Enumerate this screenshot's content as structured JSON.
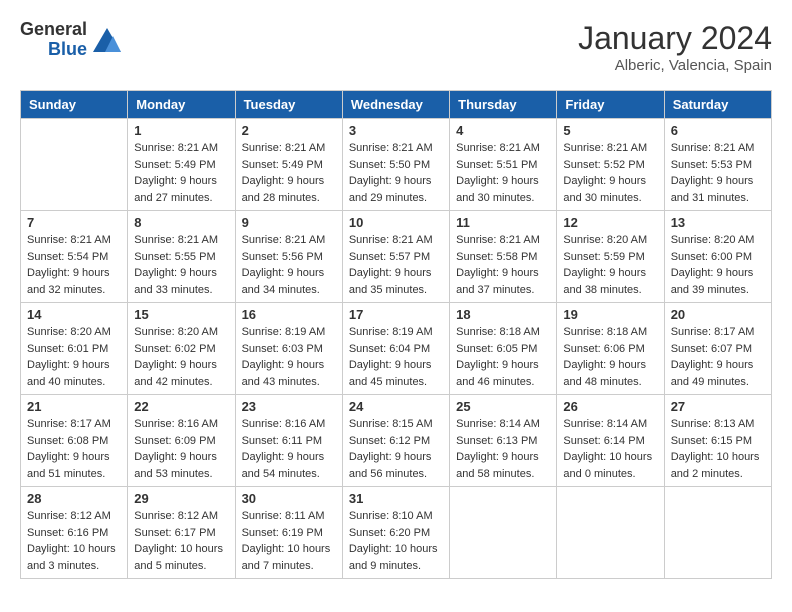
{
  "header": {
    "logo_general": "General",
    "logo_blue": "Blue",
    "month": "January 2024",
    "location": "Alberic, Valencia, Spain"
  },
  "weekdays": [
    "Sunday",
    "Monday",
    "Tuesday",
    "Wednesday",
    "Thursday",
    "Friday",
    "Saturday"
  ],
  "weeks": [
    [
      {
        "day": "",
        "sunrise": "",
        "sunset": "",
        "daylight": "",
        "empty": true
      },
      {
        "day": "1",
        "sunrise": "Sunrise: 8:21 AM",
        "sunset": "Sunset: 5:49 PM",
        "daylight": "Daylight: 9 hours and 27 minutes."
      },
      {
        "day": "2",
        "sunrise": "Sunrise: 8:21 AM",
        "sunset": "Sunset: 5:49 PM",
        "daylight": "Daylight: 9 hours and 28 minutes."
      },
      {
        "day": "3",
        "sunrise": "Sunrise: 8:21 AM",
        "sunset": "Sunset: 5:50 PM",
        "daylight": "Daylight: 9 hours and 29 minutes."
      },
      {
        "day": "4",
        "sunrise": "Sunrise: 8:21 AM",
        "sunset": "Sunset: 5:51 PM",
        "daylight": "Daylight: 9 hours and 30 minutes."
      },
      {
        "day": "5",
        "sunrise": "Sunrise: 8:21 AM",
        "sunset": "Sunset: 5:52 PM",
        "daylight": "Daylight: 9 hours and 30 minutes."
      },
      {
        "day": "6",
        "sunrise": "Sunrise: 8:21 AM",
        "sunset": "Sunset: 5:53 PM",
        "daylight": "Daylight: 9 hours and 31 minutes."
      }
    ],
    [
      {
        "day": "7",
        "sunrise": "Sunrise: 8:21 AM",
        "sunset": "Sunset: 5:54 PM",
        "daylight": "Daylight: 9 hours and 32 minutes."
      },
      {
        "day": "8",
        "sunrise": "Sunrise: 8:21 AM",
        "sunset": "Sunset: 5:55 PM",
        "daylight": "Daylight: 9 hours and 33 minutes."
      },
      {
        "day": "9",
        "sunrise": "Sunrise: 8:21 AM",
        "sunset": "Sunset: 5:56 PM",
        "daylight": "Daylight: 9 hours and 34 minutes."
      },
      {
        "day": "10",
        "sunrise": "Sunrise: 8:21 AM",
        "sunset": "Sunset: 5:57 PM",
        "daylight": "Daylight: 9 hours and 35 minutes."
      },
      {
        "day": "11",
        "sunrise": "Sunrise: 8:21 AM",
        "sunset": "Sunset: 5:58 PM",
        "daylight": "Daylight: 9 hours and 37 minutes."
      },
      {
        "day": "12",
        "sunrise": "Sunrise: 8:20 AM",
        "sunset": "Sunset: 5:59 PM",
        "daylight": "Daylight: 9 hours and 38 minutes."
      },
      {
        "day": "13",
        "sunrise": "Sunrise: 8:20 AM",
        "sunset": "Sunset: 6:00 PM",
        "daylight": "Daylight: 9 hours and 39 minutes."
      }
    ],
    [
      {
        "day": "14",
        "sunrise": "Sunrise: 8:20 AM",
        "sunset": "Sunset: 6:01 PM",
        "daylight": "Daylight: 9 hours and 40 minutes."
      },
      {
        "day": "15",
        "sunrise": "Sunrise: 8:20 AM",
        "sunset": "Sunset: 6:02 PM",
        "daylight": "Daylight: 9 hours and 42 minutes."
      },
      {
        "day": "16",
        "sunrise": "Sunrise: 8:19 AM",
        "sunset": "Sunset: 6:03 PM",
        "daylight": "Daylight: 9 hours and 43 minutes."
      },
      {
        "day": "17",
        "sunrise": "Sunrise: 8:19 AM",
        "sunset": "Sunset: 6:04 PM",
        "daylight": "Daylight: 9 hours and 45 minutes."
      },
      {
        "day": "18",
        "sunrise": "Sunrise: 8:18 AM",
        "sunset": "Sunset: 6:05 PM",
        "daylight": "Daylight: 9 hours and 46 minutes."
      },
      {
        "day": "19",
        "sunrise": "Sunrise: 8:18 AM",
        "sunset": "Sunset: 6:06 PM",
        "daylight": "Daylight: 9 hours and 48 minutes."
      },
      {
        "day": "20",
        "sunrise": "Sunrise: 8:17 AM",
        "sunset": "Sunset: 6:07 PM",
        "daylight": "Daylight: 9 hours and 49 minutes."
      }
    ],
    [
      {
        "day": "21",
        "sunrise": "Sunrise: 8:17 AM",
        "sunset": "Sunset: 6:08 PM",
        "daylight": "Daylight: 9 hours and 51 minutes."
      },
      {
        "day": "22",
        "sunrise": "Sunrise: 8:16 AM",
        "sunset": "Sunset: 6:09 PM",
        "daylight": "Daylight: 9 hours and 53 minutes."
      },
      {
        "day": "23",
        "sunrise": "Sunrise: 8:16 AM",
        "sunset": "Sunset: 6:11 PM",
        "daylight": "Daylight: 9 hours and 54 minutes."
      },
      {
        "day": "24",
        "sunrise": "Sunrise: 8:15 AM",
        "sunset": "Sunset: 6:12 PM",
        "daylight": "Daylight: 9 hours and 56 minutes."
      },
      {
        "day": "25",
        "sunrise": "Sunrise: 8:14 AM",
        "sunset": "Sunset: 6:13 PM",
        "daylight": "Daylight: 9 hours and 58 minutes."
      },
      {
        "day": "26",
        "sunrise": "Sunrise: 8:14 AM",
        "sunset": "Sunset: 6:14 PM",
        "daylight": "Daylight: 10 hours and 0 minutes."
      },
      {
        "day": "27",
        "sunrise": "Sunrise: 8:13 AM",
        "sunset": "Sunset: 6:15 PM",
        "daylight": "Daylight: 10 hours and 2 minutes."
      }
    ],
    [
      {
        "day": "28",
        "sunrise": "Sunrise: 8:12 AM",
        "sunset": "Sunset: 6:16 PM",
        "daylight": "Daylight: 10 hours and 3 minutes."
      },
      {
        "day": "29",
        "sunrise": "Sunrise: 8:12 AM",
        "sunset": "Sunset: 6:17 PM",
        "daylight": "Daylight: 10 hours and 5 minutes."
      },
      {
        "day": "30",
        "sunrise": "Sunrise: 8:11 AM",
        "sunset": "Sunset: 6:19 PM",
        "daylight": "Daylight: 10 hours and 7 minutes."
      },
      {
        "day": "31",
        "sunrise": "Sunrise: 8:10 AM",
        "sunset": "Sunset: 6:20 PM",
        "daylight": "Daylight: 10 hours and 9 minutes."
      },
      {
        "day": "",
        "sunrise": "",
        "sunset": "",
        "daylight": "",
        "empty": true
      },
      {
        "day": "",
        "sunrise": "",
        "sunset": "",
        "daylight": "",
        "empty": true
      },
      {
        "day": "",
        "sunrise": "",
        "sunset": "",
        "daylight": "",
        "empty": true
      }
    ]
  ]
}
